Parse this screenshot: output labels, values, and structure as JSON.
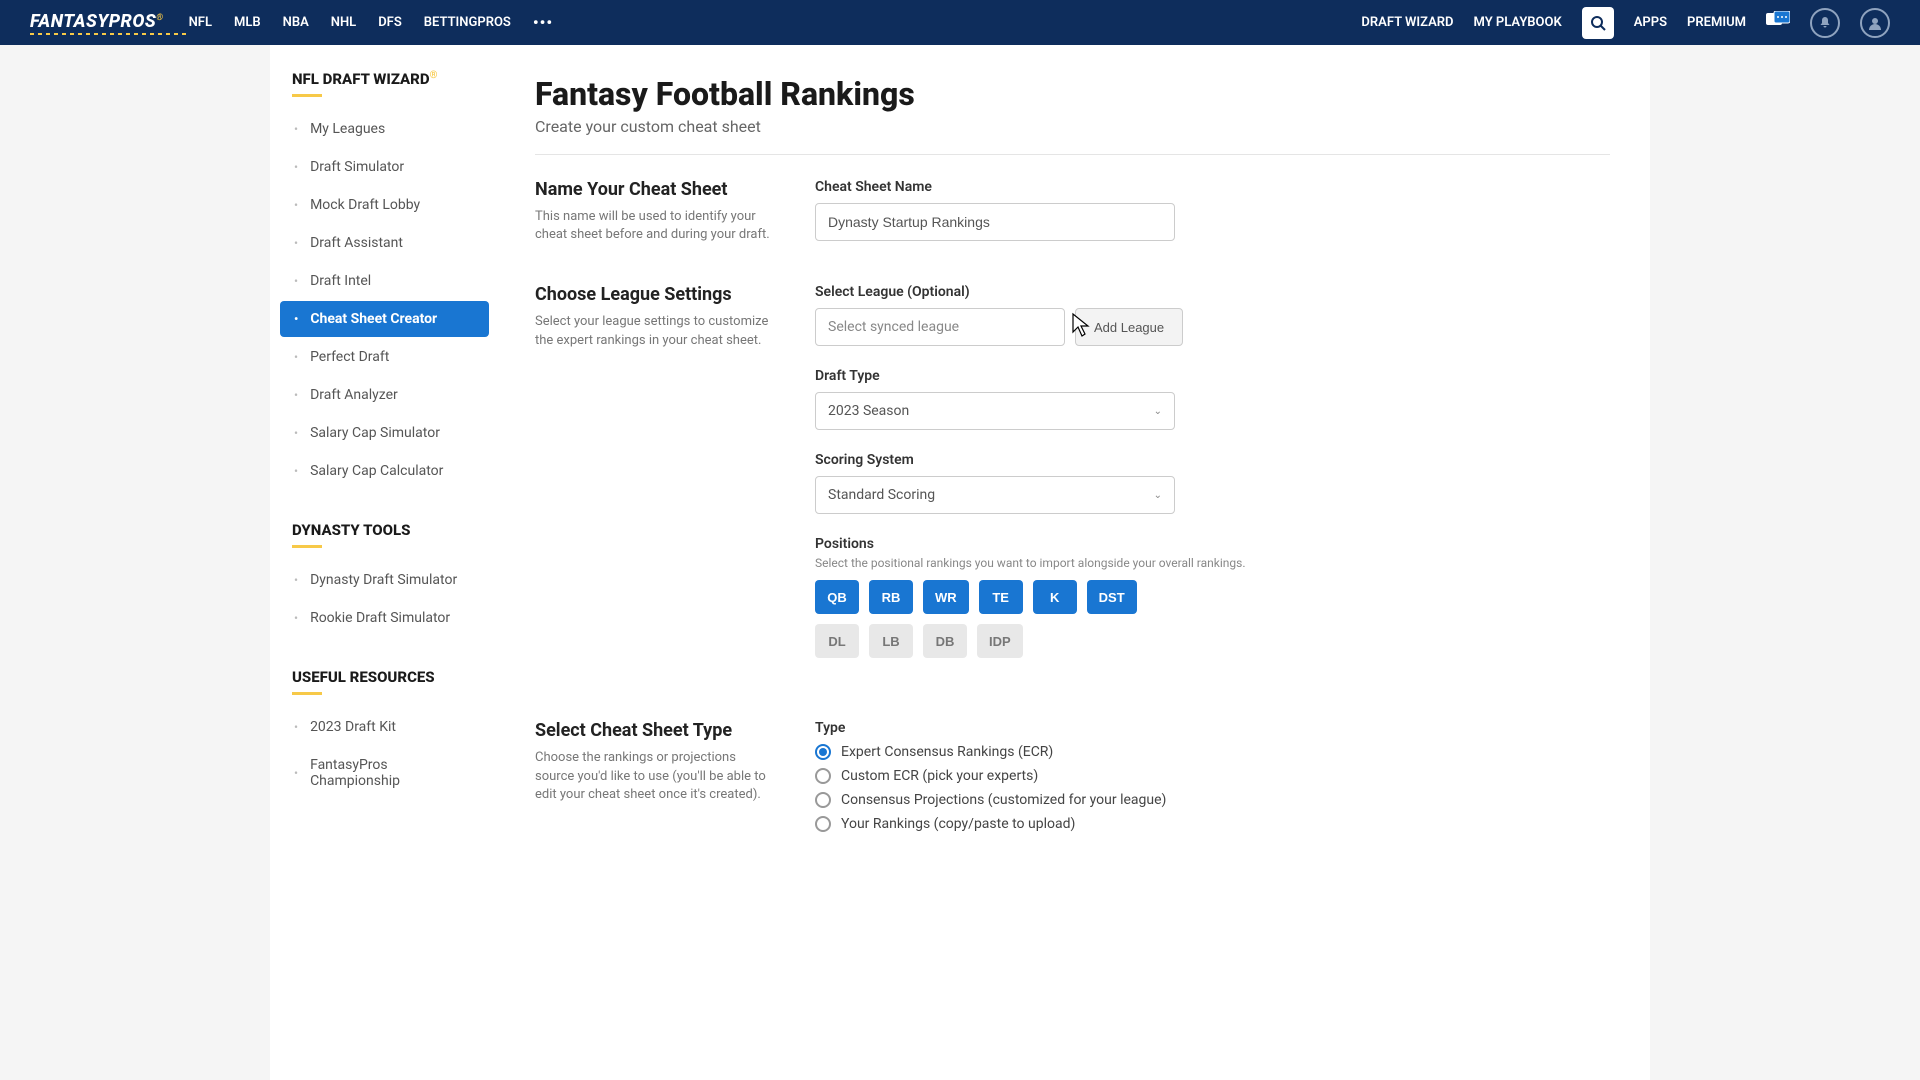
{
  "header": {
    "logo": "FANTASYPROS",
    "nav_left": [
      "NFL",
      "MLB",
      "NBA",
      "NHL",
      "DFS",
      "BETTINGPROS"
    ],
    "nav_right": [
      "DRAFT WIZARD",
      "MY PLAYBOOK",
      "APPS",
      "PREMIUM"
    ]
  },
  "sidebar": {
    "groups": [
      {
        "title": "NFL DRAFT WIZARD",
        "sup": "®",
        "items": [
          {
            "label": "My Leagues",
            "active": false
          },
          {
            "label": "Draft Simulator",
            "active": false
          },
          {
            "label": "Mock Draft Lobby",
            "active": false
          },
          {
            "label": "Draft Assistant",
            "active": false
          },
          {
            "label": "Draft Intel",
            "active": false
          },
          {
            "label": "Cheat Sheet Creator",
            "active": true
          },
          {
            "label": "Perfect Draft",
            "active": false
          },
          {
            "label": "Draft Analyzer",
            "active": false
          },
          {
            "label": "Salary Cap Simulator",
            "active": false
          },
          {
            "label": "Salary Cap Calculator",
            "active": false
          }
        ]
      },
      {
        "title": "DYNASTY TOOLS",
        "items": [
          {
            "label": "Dynasty Draft Simulator",
            "active": false
          },
          {
            "label": "Rookie Draft Simulator",
            "active": false
          }
        ]
      },
      {
        "title": "USEFUL RESOURCES",
        "items": [
          {
            "label": "2023 Draft Kit",
            "active": false
          },
          {
            "label": "FantasyPros Championship",
            "active": false
          }
        ]
      }
    ]
  },
  "page": {
    "title": "Fantasy Football Rankings",
    "subtitle": "Create your custom cheat sheet"
  },
  "sections": {
    "name": {
      "title": "Name Your Cheat Sheet",
      "desc": "This name will be used to identify your cheat sheet before and during your draft.",
      "field_label": "Cheat Sheet Name",
      "value": "Dynasty Startup Rankings"
    },
    "league": {
      "title": "Choose League Settings",
      "desc": "Select your league settings to customize the expert rankings in your cheat sheet.",
      "select_label": "Select League (Optional)",
      "select_placeholder": "Select synced league",
      "add_league": "Add League",
      "draft_type_label": "Draft Type",
      "draft_type_value": "2023 Season",
      "scoring_label": "Scoring System",
      "scoring_value": "Standard Scoring",
      "positions_label": "Positions",
      "positions_hint": "Select the positional rankings you want to import alongside your overall rankings.",
      "positions_on": [
        "QB",
        "RB",
        "WR",
        "TE",
        "K",
        "DST"
      ],
      "positions_off": [
        "DL",
        "LB",
        "DB",
        "IDP"
      ]
    },
    "type": {
      "title": "Select Cheat Sheet Type",
      "desc": "Choose the rankings or projections source you'd like to use (you'll be able to edit your cheat sheet once it's created).",
      "label": "Type",
      "options": [
        {
          "label": "Expert Consensus Rankings (ECR)",
          "selected": true
        },
        {
          "label": "Custom ECR (pick your experts)",
          "selected": false
        },
        {
          "label": "Consensus Projections (customized for your league)",
          "selected": false
        },
        {
          "label": "Your Rankings (copy/paste to upload)",
          "selected": false
        }
      ]
    }
  }
}
